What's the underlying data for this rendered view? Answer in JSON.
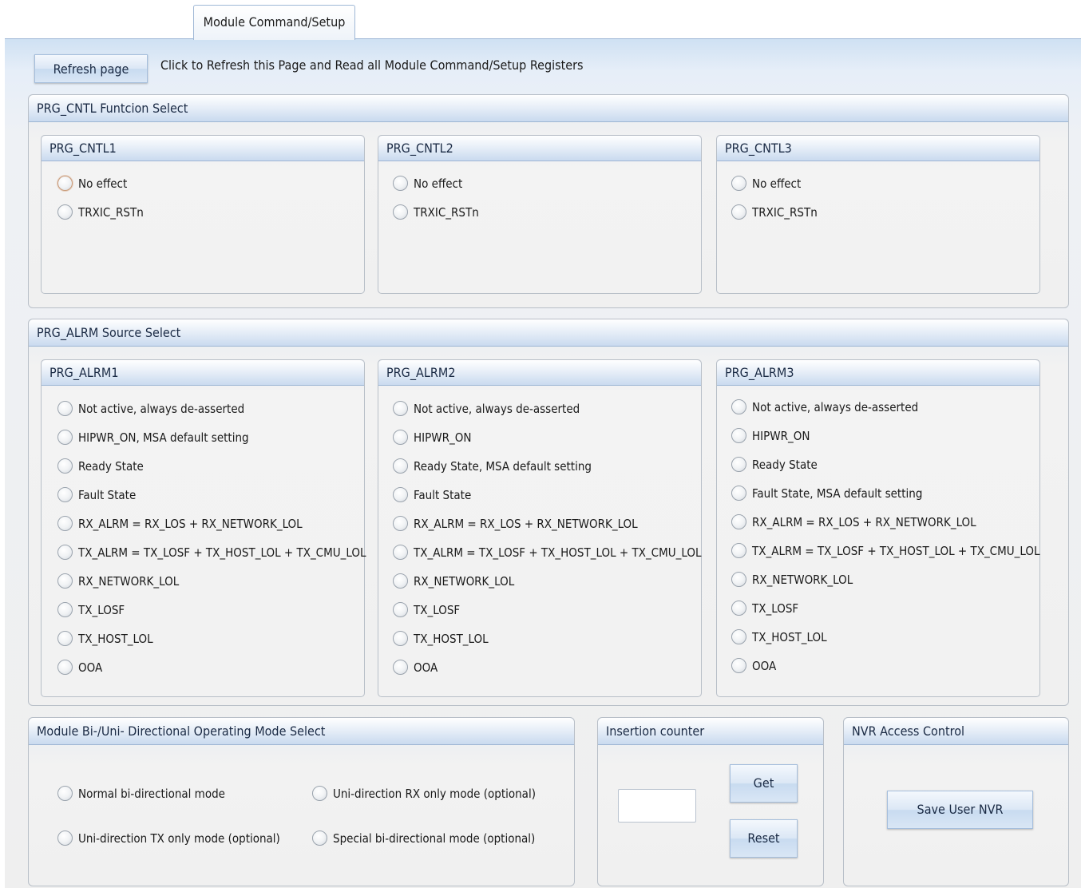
{
  "tab": {
    "label": "Module Command/Setup"
  },
  "toolbar": {
    "refresh_label": "Refresh page",
    "refresh_hint": "Click to Refresh this Page and Read all Module Command/Setup Registers"
  },
  "prg_cntl": {
    "title": "PRG_CNTL Funtcion Select",
    "groups": [
      {
        "title": "PRG_CNTL1",
        "options": [
          "No effect",
          "TRXIC_RSTn"
        ]
      },
      {
        "title": "PRG_CNTL2",
        "options": [
          "No effect",
          "TRXIC_RSTn"
        ]
      },
      {
        "title": "PRG_CNTL3",
        "options": [
          "No effect",
          "TRXIC_RSTn"
        ]
      }
    ]
  },
  "prg_alrm": {
    "title": "PRG_ALRM Source Select",
    "groups": [
      {
        "title": "PRG_ALRM1",
        "options": [
          "Not active, always de-asserted",
          "HIPWR_ON, MSA default setting",
          "Ready State",
          "Fault State",
          "RX_ALRM = RX_LOS + RX_NETWORK_LOL",
          "TX_ALRM = TX_LOSF + TX_HOST_LOL + TX_CMU_LOL",
          "RX_NETWORK_LOL",
          "TX_LOSF",
          "TX_HOST_LOL",
          "OOA"
        ]
      },
      {
        "title": "PRG_ALRM2",
        "options": [
          "Not active, always de-asserted",
          "HIPWR_ON",
          "Ready State, MSA default setting",
          "Fault State",
          "RX_ALRM = RX_LOS + RX_NETWORK_LOL",
          "TX_ALRM = TX_LOSF + TX_HOST_LOL + TX_CMU_LOL",
          "RX_NETWORK_LOL",
          "TX_LOSF",
          "TX_HOST_LOL",
          "OOA"
        ]
      },
      {
        "title": "PRG_ALRM3",
        "options": [
          "Not active, always de-asserted",
          "HIPWR_ON",
          "Ready State",
          "Fault State, MSA default setting",
          "RX_ALRM = RX_LOS + RX_NETWORK_LOL",
          "TX_ALRM = TX_LOSF + TX_HOST_LOL + TX_CMU_LOL",
          "RX_NETWORK_LOL",
          "TX_LOSF",
          "TX_HOST_LOL",
          "OOA"
        ]
      }
    ]
  },
  "mode": {
    "title": "Module Bi-/Uni- Directional Operating Mode Select",
    "options": [
      "Normal bi-directional mode",
      "Uni-direction RX only mode (optional)",
      "Uni-direction TX only mode (optional)",
      "Special bi-directional mode (optional)"
    ]
  },
  "insertion": {
    "title": "Insertion counter",
    "value": "",
    "get_label": "Get",
    "reset_label": "Reset"
  },
  "nvr": {
    "title": "NVR Access Control",
    "save_label": "Save User NVR"
  }
}
